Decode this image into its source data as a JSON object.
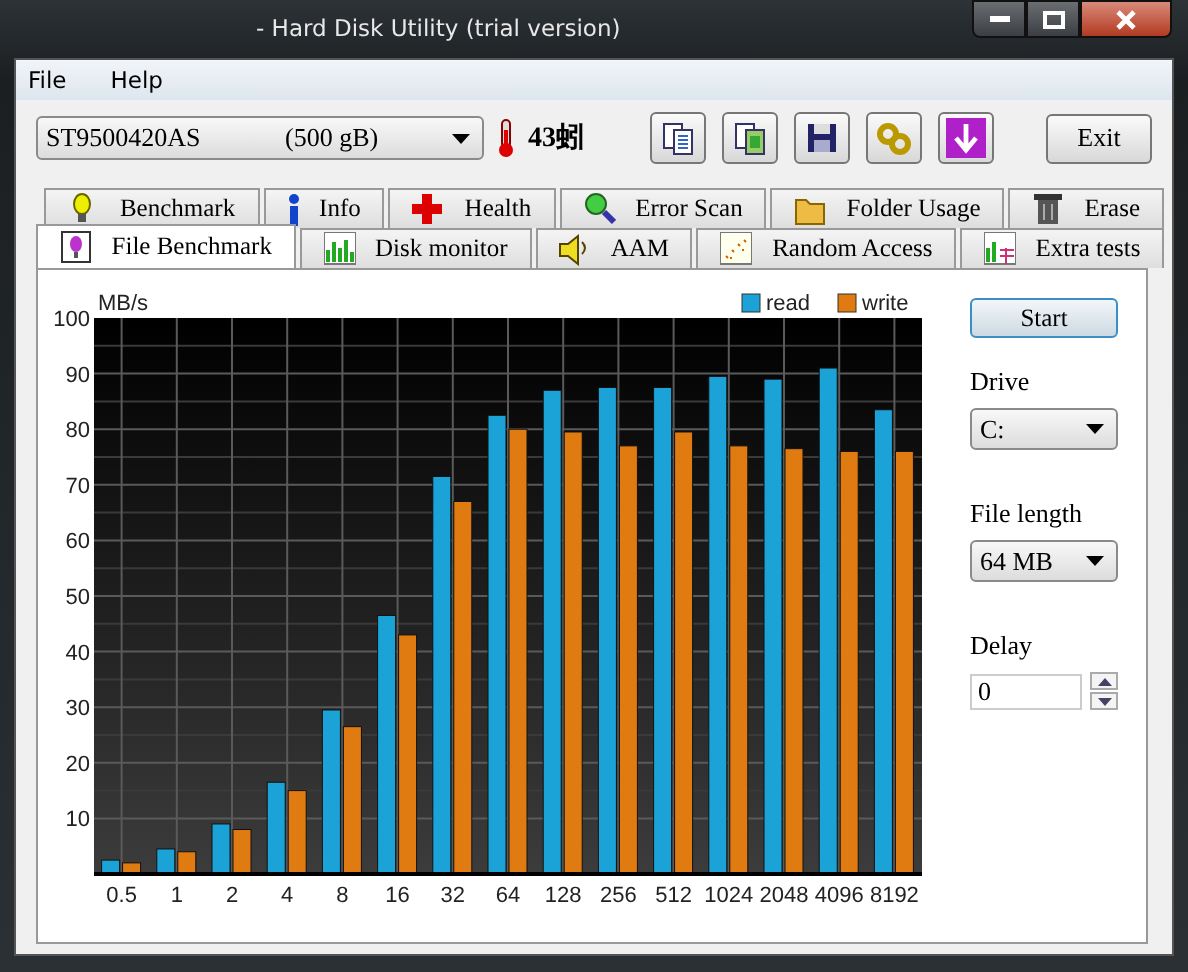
{
  "window": {
    "title": "- Hard Disk Utility (trial version)"
  },
  "menu": [
    "File",
    "Help"
  ],
  "toolbar": {
    "drive": "ST9500420AS             (500 gB)",
    "temperature": "43蚓",
    "exit": "Exit"
  },
  "tabs": [
    [
      {
        "label": "Benchmark",
        "selected": false
      },
      {
        "label": "Info",
        "selected": false
      },
      {
        "label": "Health",
        "selected": false
      },
      {
        "label": "Error Scan",
        "selected": false
      },
      {
        "label": "Folder Usage",
        "selected": false
      },
      {
        "label": "Erase",
        "selected": false
      }
    ],
    [
      {
        "label": "File Benchmark",
        "selected": true
      },
      {
        "label": "Disk monitor",
        "selected": false
      },
      {
        "label": "AAM",
        "selected": false
      },
      {
        "label": "Random Access",
        "selected": false
      },
      {
        "label": "Extra tests",
        "selected": false
      }
    ]
  ],
  "panel": {
    "chart_data": {
      "type": "bar",
      "ylabel": "MB/s",
      "categories": [
        "0.5",
        "1",
        "2",
        "4",
        "8",
        "16",
        "32",
        "64",
        "128",
        "256",
        "512",
        "1024",
        "2048",
        "4096",
        "8192"
      ],
      "ylim": [
        0,
        100
      ],
      "grid": true,
      "yticks": [
        10,
        20,
        30,
        40,
        50,
        60,
        70,
        80,
        90,
        100
      ],
      "series": [
        {
          "name": "read",
          "color": "#1ba3d8",
          "values": [
            2.5,
            4.5,
            9,
            16.5,
            29.5,
            46.5,
            71.5,
            82.5,
            87,
            87.5,
            87.5,
            89.5,
            89,
            91,
            83.5
          ]
        },
        {
          "name": "write",
          "color": "#e07b12",
          "values": [
            2,
            4,
            8,
            15,
            26.5,
            43,
            67,
            80,
            79.5,
            77,
            79.5,
            77,
            76.5,
            76,
            76
          ]
        }
      ]
    },
    "start": "Start",
    "drive_label": "Drive",
    "drive": "C:",
    "file_length_label": "File length",
    "file_length": "64 MB",
    "delay_label": "Delay",
    "delay": "0"
  }
}
